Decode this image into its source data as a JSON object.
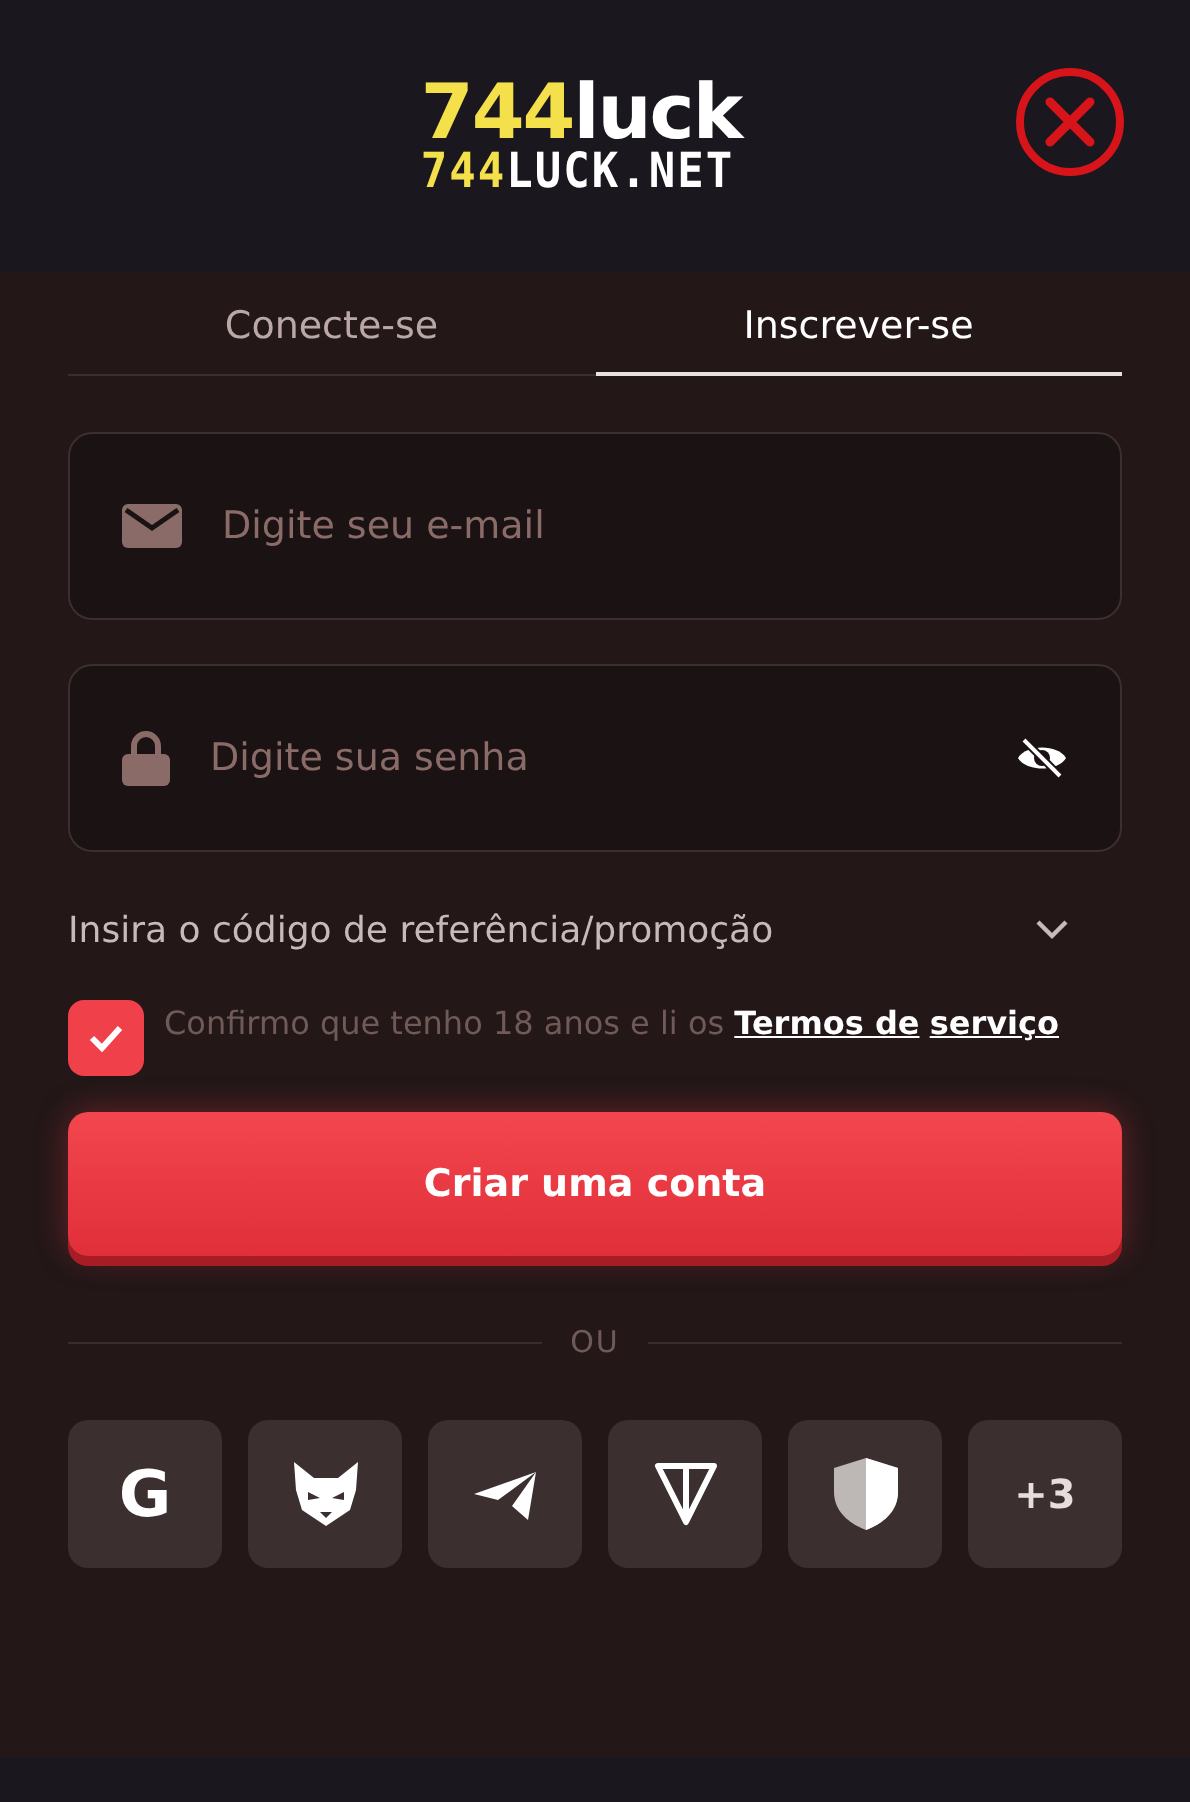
{
  "header": {
    "logo_top": {
      "number": "744",
      "word": "luck"
    },
    "logo_bottom": {
      "number": "744",
      "word": "LUCK.NET"
    }
  },
  "tabs": [
    {
      "label": "Conecte-se",
      "selected": false
    },
    {
      "label": "Inscrever-se",
      "selected": true
    }
  ],
  "fields": [
    {
      "kind": "email",
      "placeholder": "Digite seu e-mail"
    },
    {
      "kind": "password",
      "placeholder": "Digite sua senha"
    }
  ],
  "referral": {
    "label": "Insira o código de referência/promoção",
    "expanded": false
  },
  "terms": {
    "checked": true,
    "text": "Confirmo que tenho 18 anos e li os",
    "link": "Termos de serviço"
  },
  "submit": "Criar uma conta",
  "divider": "OU",
  "social": [
    {
      "kind": "google",
      "text": "G"
    },
    {
      "kind": "fox"
    },
    {
      "kind": "telegram"
    },
    {
      "kind": "ton"
    },
    {
      "kind": "shield"
    },
    {
      "kind": "more",
      "text": "+3"
    }
  ]
}
